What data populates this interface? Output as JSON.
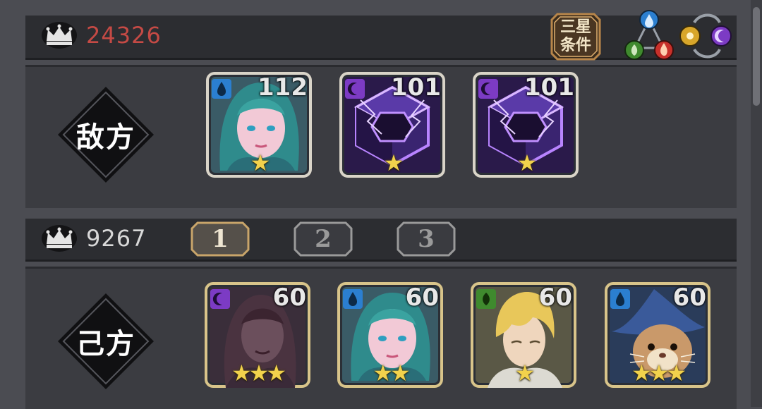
{
  "enemy": {
    "power": "24326",
    "side_label": "敌方",
    "units": [
      {
        "level": "112",
        "stars": "★",
        "element": "water",
        "portrait": "teal-haired-sorceress"
      },
      {
        "level": "101",
        "stars": "★",
        "element": "moon",
        "portrait": "purple-crystal-cube"
      },
      {
        "level": "101",
        "stars": "★",
        "element": "moon",
        "portrait": "purple-crystal-cube"
      }
    ]
  },
  "three_star_button": {
    "line1": "三星",
    "line2": "条件"
  },
  "element_cycles": {
    "cycle1": [
      "water-icon",
      "nature-icon",
      "fire-icon"
    ],
    "cycle2": [
      "sun-icon",
      "moon-icon"
    ]
  },
  "player": {
    "power": "9267",
    "side_label": "己方",
    "team_tabs": [
      {
        "label": "1",
        "selected": true
      },
      {
        "label": "2",
        "selected": false
      },
      {
        "label": "3",
        "selected": false
      }
    ],
    "units": [
      {
        "level": "60",
        "stars": "★★★",
        "element": "moon",
        "portrait": "shadowed-long-haired-figure"
      },
      {
        "level": "60",
        "stars": "★★",
        "element": "water",
        "portrait": "teal-haired-sorceress"
      },
      {
        "level": "60",
        "stars": "★",
        "element": "nature",
        "portrait": "blond-swordsman"
      },
      {
        "level": "60",
        "stars": "★★★",
        "element": "water",
        "portrait": "hamster-wizard"
      }
    ]
  },
  "colors": {
    "enemy_power": "#c54a45",
    "player_power": "#d8d8d8",
    "star": "#f2d24c",
    "tab_selected_border": "#c9a56a",
    "tab_border": "#9a9a9a",
    "water": "#2b7fd0",
    "moon": "#7c3bc4",
    "nature": "#3f8a2e",
    "fire": "#c8302a",
    "sun": "#d8a62a"
  }
}
